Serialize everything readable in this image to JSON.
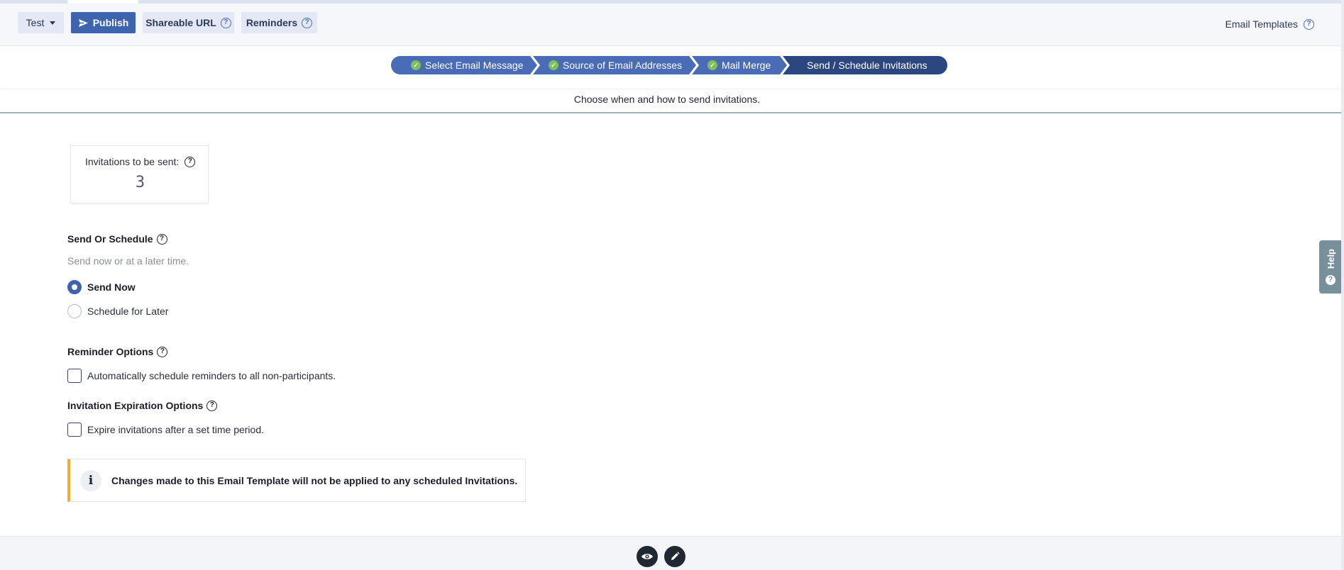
{
  "toolbar": {
    "test_label": "Test",
    "publish_label": "Publish",
    "shareable_label": "Shareable URL",
    "reminders_label": "Reminders",
    "email_templates_label": "Email Templates"
  },
  "steps": [
    {
      "label": "Select Email Message",
      "state": "complete"
    },
    {
      "label": "Source of Email Addresses",
      "state": "complete"
    },
    {
      "label": "Mail Merge",
      "state": "complete"
    },
    {
      "label": "Send / Schedule Invitations",
      "state": "active"
    }
  ],
  "subtitle": "Choose when and how to send invitations.",
  "invitations": {
    "label": "Invitations to be sent:",
    "count": "3"
  },
  "send_or_schedule": {
    "title": "Send Or Schedule",
    "description": "Send now or at a later time.",
    "options": [
      {
        "label": "Send Now",
        "selected": true
      },
      {
        "label": "Schedule for Later",
        "selected": false
      }
    ]
  },
  "reminder_options": {
    "title": "Reminder Options",
    "checkbox_label": "Automatically schedule reminders to all non-participants.",
    "checked": false
  },
  "expiration_options": {
    "title": "Invitation Expiration Options",
    "checkbox_label": "Expire invitations after a set time period.",
    "checked": false
  },
  "notice": {
    "text": "Changes made to this Email Template will not be applied to any scheduled Invitations."
  },
  "help_tab": {
    "label": "Help"
  },
  "colors": {
    "primary": "#3d64ad",
    "step_complete": "#4a6cb7",
    "step_active": "#2c477f",
    "check_green": "#7fc05a",
    "notice_accent": "#f1b130"
  },
  "icons": [
    "caret-down-icon",
    "send-icon",
    "question-icon",
    "check-icon",
    "info-icon",
    "eye-icon",
    "pencil-icon"
  ]
}
